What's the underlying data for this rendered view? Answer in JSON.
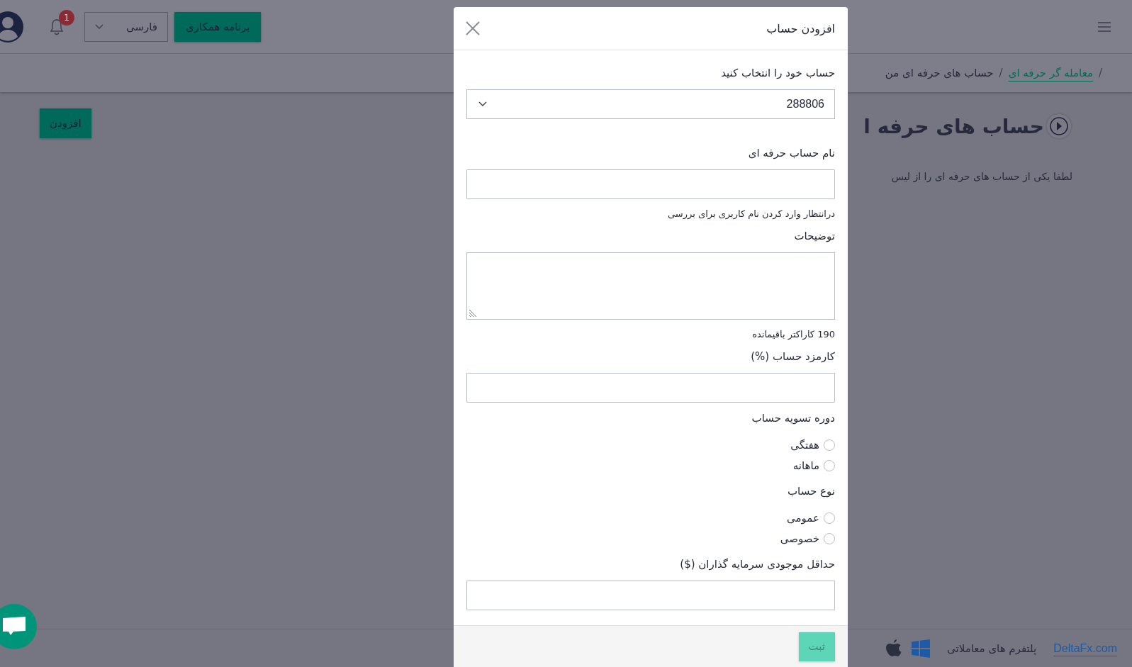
{
  "header": {
    "notification_count": "1",
    "language": "فارسی",
    "partner_button": "برنامه همکاری"
  },
  "breadcrumb": [
    {
      "separator": "/",
      "label": "معامله گر حرفه ای",
      "link": true
    },
    {
      "separator": "/",
      "label": "حساب های حرفه ای من",
      "link": false
    }
  ],
  "page": {
    "title": "حساب های حرفه ا",
    "description": "لطفا یکی از حساب های حرفه ای را از لیس",
    "add_button": "افزودن"
  },
  "footer": {
    "site_link": "DeltaFx.com",
    "platforms_label": "پلتفرم های معاملاتی"
  },
  "dialog": {
    "title": "افزودن حساب",
    "fields": [
      {
        "kind": "select",
        "label": "حساب خود را انتخاب کنید",
        "value": "288806"
      },
      {
        "kind": "text",
        "label": "نام حساب حرفه ای",
        "hint": "درانتظار وارد کردن نام کاربری برای بررسی"
      },
      {
        "kind": "textarea",
        "label": "توضیحات",
        "counter": "190 کاراکتر باقیمانده"
      },
      {
        "kind": "text",
        "label": "کارمزد حساب (%)"
      },
      {
        "kind": "radio",
        "label": "دوره تسویه حساب",
        "options": [
          {
            "label": "هفتگی",
            "selected": false
          },
          {
            "label": "ماهانه",
            "selected": false
          }
        ]
      },
      {
        "kind": "radio",
        "label": "نوع حساب",
        "options": [
          {
            "label": "عمومی",
            "selected": false
          },
          {
            "label": "خصوصی",
            "selected": false
          }
        ]
      },
      {
        "kind": "text",
        "label": "حداقل موجودی سرمایه گذاران ($)"
      }
    ],
    "submit": {
      "label": "ثبت",
      "disabled": true
    }
  }
}
